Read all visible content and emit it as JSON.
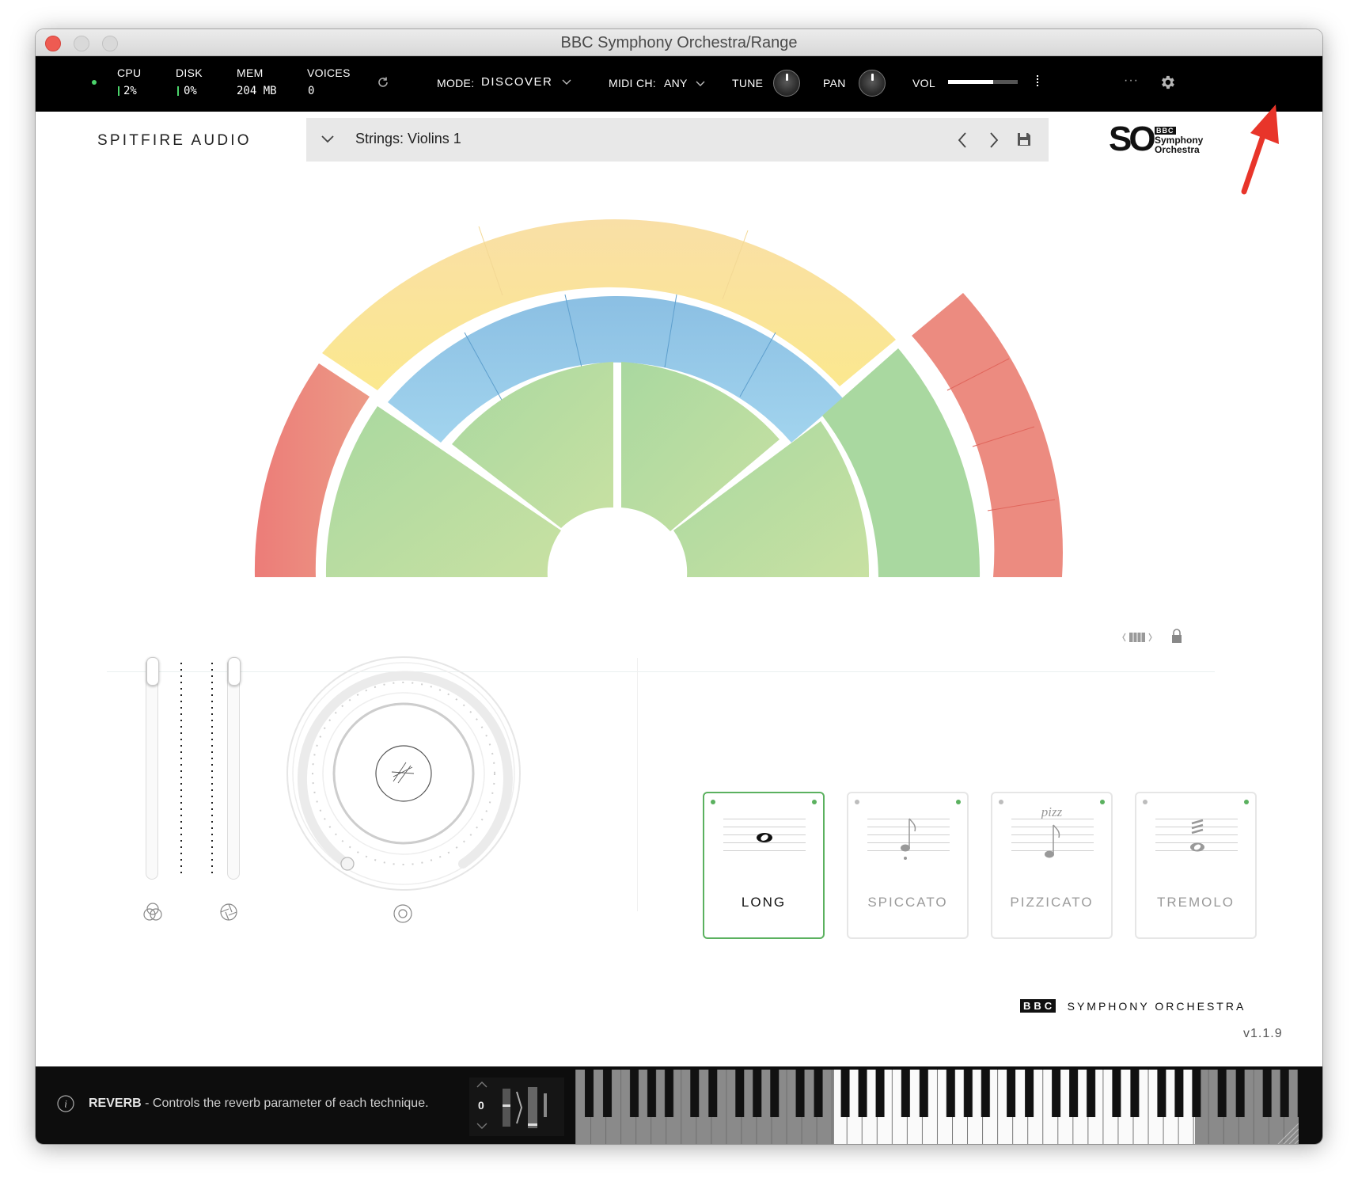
{
  "window": {
    "title": "BBC Symphony Orchestra/Range"
  },
  "topbar": {
    "cpu_label": "CPU",
    "cpu_value": "2%",
    "disk_label": "DISK",
    "disk_value": "0%",
    "mem_label": "MEM",
    "mem_value": "204 MB",
    "voices_label": "VOICES",
    "voices_value": "0",
    "mode_label": "MODE:",
    "mode_value": "DISCOVER",
    "midi_label": "MIDI CH:",
    "midi_value": "ANY",
    "tune_label": "TUNE",
    "pan_label": "PAN",
    "vol_label": "VOL",
    "vol_level": 0.65,
    "more_label": "···"
  },
  "header": {
    "brand": "SPITFIRE AUDIO",
    "preset": "Strings: Violins 1",
    "logo_so": "SO",
    "logo_bbc": "BBC",
    "logo_line1": "Symphony",
    "logo_line2": "Orchestra"
  },
  "articulations": [
    {
      "label": "LONG",
      "selected": true,
      "mark": ""
    },
    {
      "label": "SPICCATO",
      "selected": false,
      "mark": ""
    },
    {
      "label": "PIZZICATO",
      "selected": false,
      "mark": "pizz"
    },
    {
      "label": "TREMOLO",
      "selected": false,
      "mark": ""
    }
  ],
  "footer_brand": {
    "bbc": "BBC",
    "text": "SYMPHONY ORCHESTRA"
  },
  "version": "v1.1.9",
  "status": {
    "title": "REVERB",
    "text": " - Controls the reverb parameter of each technique."
  },
  "transpose": {
    "value": "0"
  },
  "colors": {
    "accent_green": "#5bb15f",
    "annotation_red": "#e8352a"
  }
}
